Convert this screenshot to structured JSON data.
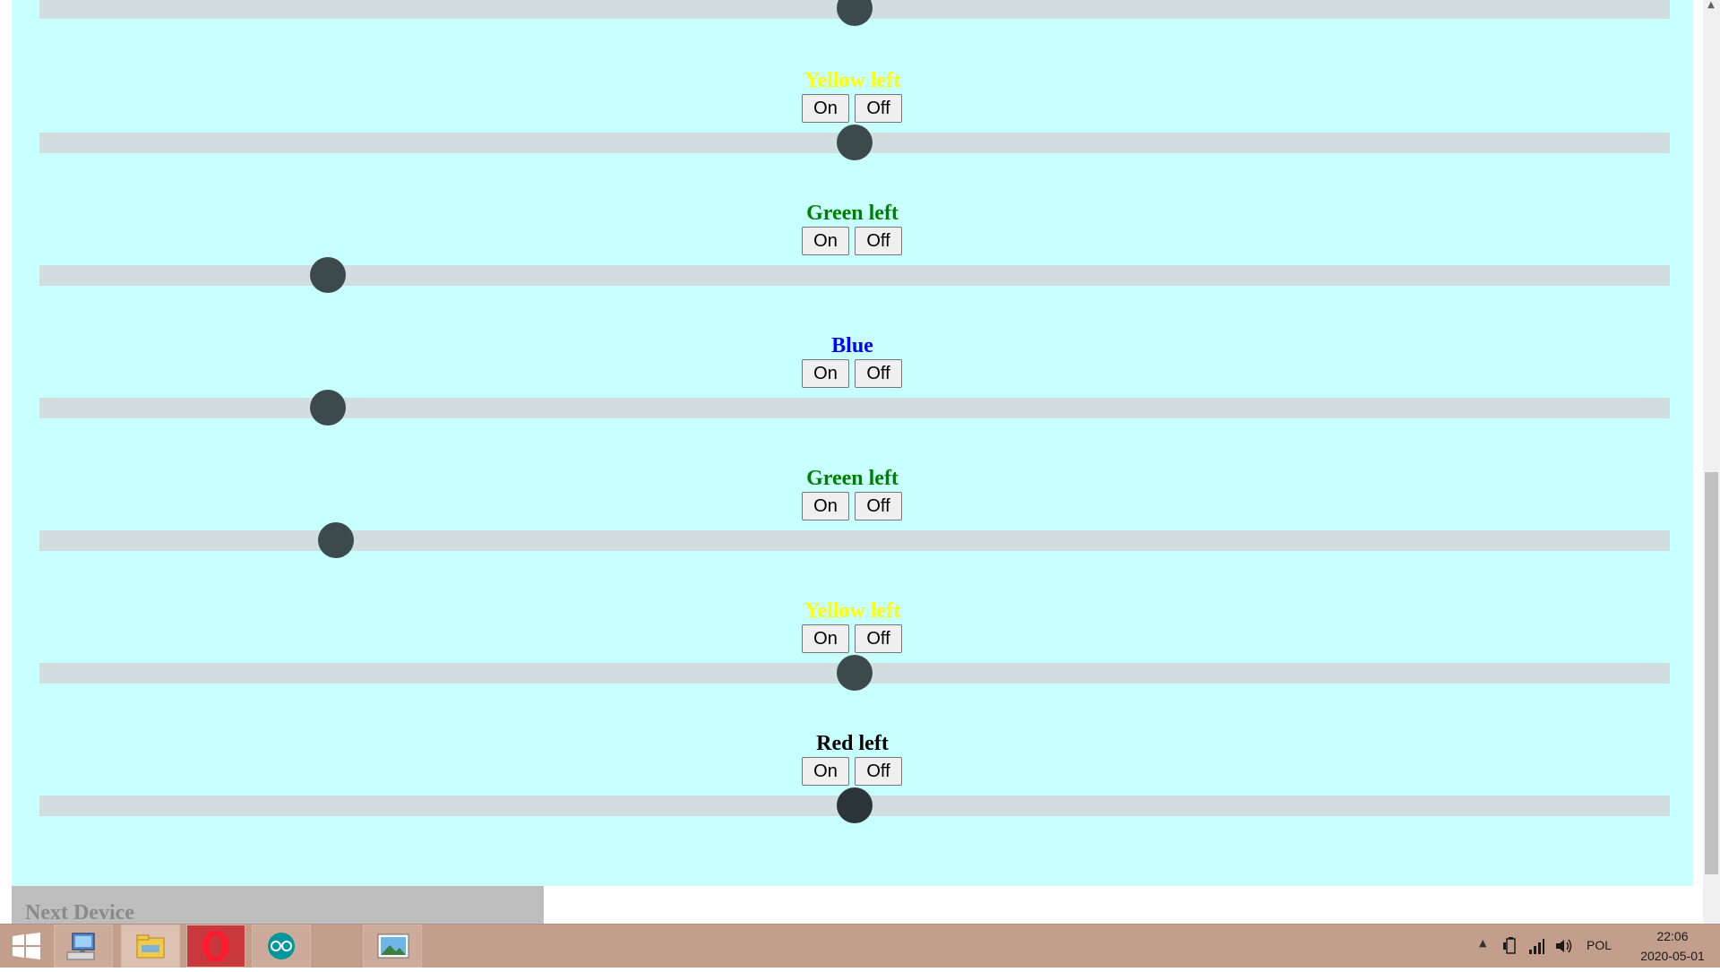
{
  "controls": [
    {
      "label": "",
      "color": "#000000",
      "on_label": "",
      "off_label": "",
      "level": 0.5
    },
    {
      "label": "Yellow left",
      "color": "#ffff00",
      "on_label": "On",
      "off_label": "Off",
      "level": 0.5
    },
    {
      "label": "Green left",
      "color": "#008000",
      "on_label": "On",
      "off_label": "Off",
      "level": 0.177
    },
    {
      "label": "Blue",
      "color": "#0000ff",
      "on_label": "On",
      "off_label": "Off",
      "level": 0.177
    },
    {
      "label": "Green left",
      "color": "#008000",
      "on_label": "On",
      "off_label": "Off",
      "level": 0.182
    },
    {
      "label": "Yellow left",
      "color": "#ffff00",
      "on_label": "On",
      "off_label": "Off",
      "level": 0.5
    },
    {
      "label": "Red left",
      "color": "#000000",
      "on_label": "On",
      "off_label": "Off",
      "level": 0.5
    }
  ],
  "next_device": {
    "label": "Next Device"
  },
  "colors": {
    "page_background": "#c8ffff",
    "slider_track": "#d2dde0",
    "slider_thumb": "#3d4a4d",
    "taskbar": "#c49e8c"
  },
  "taskbar": {
    "apps": [
      {
        "name": "windows-start-icon"
      },
      {
        "name": "computer-icon"
      },
      {
        "name": "file-explorer-icon"
      },
      {
        "name": "opera-browser-icon"
      },
      {
        "name": "arduino-icon"
      },
      {
        "name": "photos-icon"
      }
    ],
    "language": "POL",
    "time": "22:06",
    "date": "2020-05-01"
  }
}
